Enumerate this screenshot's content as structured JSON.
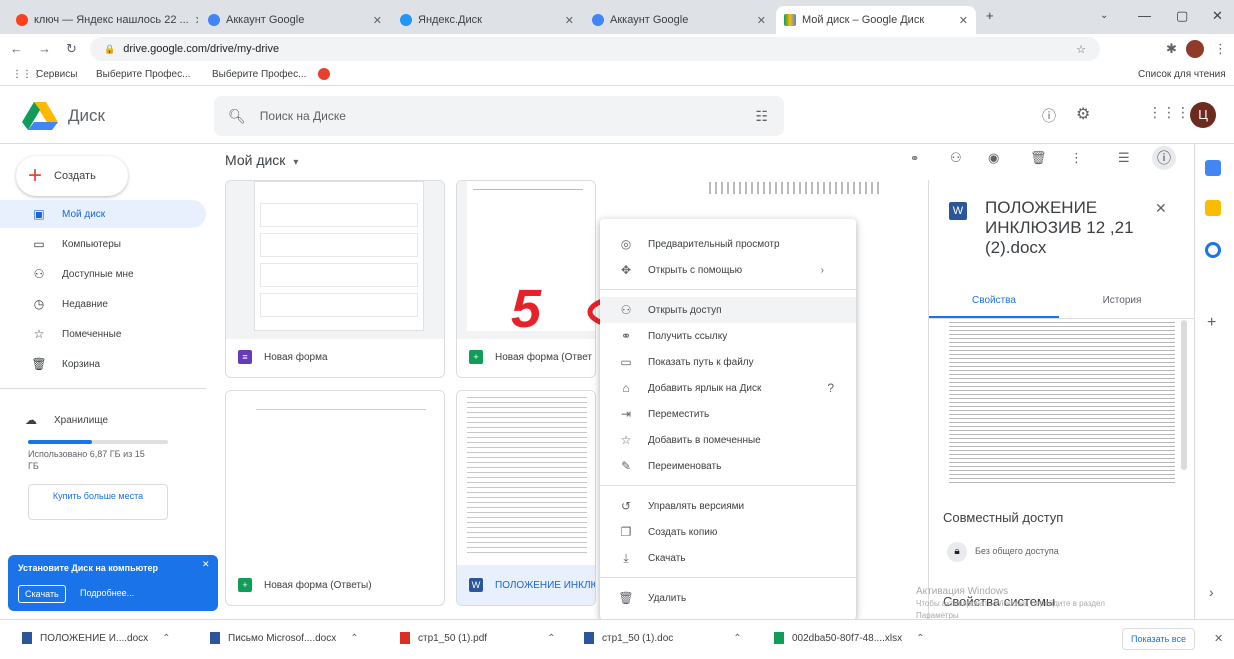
{
  "colors": {
    "accent": "#1a73e8",
    "tab_strip": "#dee1e6",
    "nav_active_bg": "#e8f0fe",
    "annotation_red": "#e8202a",
    "word_blue": "#2b579a",
    "forms_purple": "#673ab7",
    "sheets_green": "#0f9d58"
  },
  "browser": {
    "tabs": [
      {
        "label": "ключ — Яндекс нашлось 22 ...",
        "active": false
      },
      {
        "label": "Аккаунт Google",
        "active": false
      },
      {
        "label": "Яндекс.Диск",
        "active": false
      },
      {
        "label": "Аккаунт Google",
        "active": false
      },
      {
        "label": "Мой диск – Google Диск",
        "active": true
      }
    ],
    "new_tab": "+",
    "address": "drive.google.com/drive/my-drive",
    "bookmarks": [
      "Сервисы",
      "Выберите Профес...",
      "Выберите Профес..."
    ],
    "reading_list": "Список для чтения"
  },
  "drive": {
    "app_name": "Диск",
    "search_placeholder": "Поиск на Диске",
    "avatar_letter": "Ц",
    "create_label": "Создать",
    "nav": [
      {
        "label": "Мой диск",
        "icon": "my-drive-icon",
        "active": true
      },
      {
        "label": "Компьютеры",
        "icon": "computer-icon",
        "active": false
      },
      {
        "label": "Доступные мне",
        "icon": "shared-icon",
        "active": false
      },
      {
        "label": "Недавние",
        "icon": "clock-icon",
        "active": false
      },
      {
        "label": "Помеченные",
        "icon": "star-icon",
        "active": false
      },
      {
        "label": "Корзина",
        "icon": "trash-icon",
        "active": false
      }
    ],
    "storage": {
      "label": "Хранилище",
      "used_text": "Использовано 6,87 ГБ из 15 ГБ",
      "used_fraction": 0.46,
      "buy_label": "Купить больше места"
    },
    "install_banner": {
      "text": "Установите Диск на компьютер",
      "download_button": "Скачать",
      "more_button": "Подробнее..."
    },
    "breadcrumb": "Мой диск",
    "files": [
      {
        "name": "Новая форма",
        "type": "forms"
      },
      {
        "name": "Новая форма (Ответ",
        "type": "sheets"
      },
      {
        "name": "Новая форма (Ответы)",
        "type": "sheets"
      },
      {
        "name": "ПОЛОЖЕНИЕ ИНКЛЮ",
        "type": "word"
      }
    ]
  },
  "context_menu": {
    "items": [
      {
        "label": "Предварительный просмотр",
        "icon": "eye-icon"
      },
      {
        "label": "Открыть с помощью",
        "icon": "open-with-icon",
        "submenu": true
      },
      {
        "label": "Открыть доступ",
        "icon": "add-person-icon",
        "highlighted": true
      },
      {
        "label": "Получить ссылку",
        "icon": "link-icon"
      },
      {
        "label": "Показать путь к файлу",
        "icon": "folder-icon"
      },
      {
        "label": "Добавить ярлык на Диск",
        "icon": "shortcut-icon",
        "help": true
      },
      {
        "label": "Переместить",
        "icon": "move-icon"
      },
      {
        "label": "Добавить в помеченные",
        "icon": "star-icon"
      },
      {
        "label": "Переименовать",
        "icon": "pencil-icon"
      },
      {
        "label": "Управлять версиями",
        "icon": "history-icon"
      },
      {
        "label": "Создать копию",
        "icon": "copy-icon"
      },
      {
        "label": "Скачать",
        "icon": "download-icon"
      },
      {
        "label": "Удалить",
        "icon": "trash-icon"
      }
    ]
  },
  "annotation": {
    "number": "5"
  },
  "details": {
    "title": "ПОЛОЖЕНИЕ ИНКЛЮЗИВ 12 ,21 (2).docx",
    "tabs": [
      "Свойства",
      "История"
    ],
    "sharing_heading": "Совместный доступ",
    "sharing_status": "Без общего доступа",
    "system_props": "Свойства системы"
  },
  "watermark": {
    "line1": "Активация Windows",
    "line2": "Чтобы активировать Windows, перейдите в раздел",
    "line3": "Параметры"
  },
  "downloads": [
    "ПОЛОЖЕНИЕ И....docx",
    "Письмо Microsof....docx",
    "стр1_50 (1).pdf",
    "стр1_50 (1).doc",
    "002dba50-80f7-48....xlsx"
  ],
  "show_all": "Показать все"
}
